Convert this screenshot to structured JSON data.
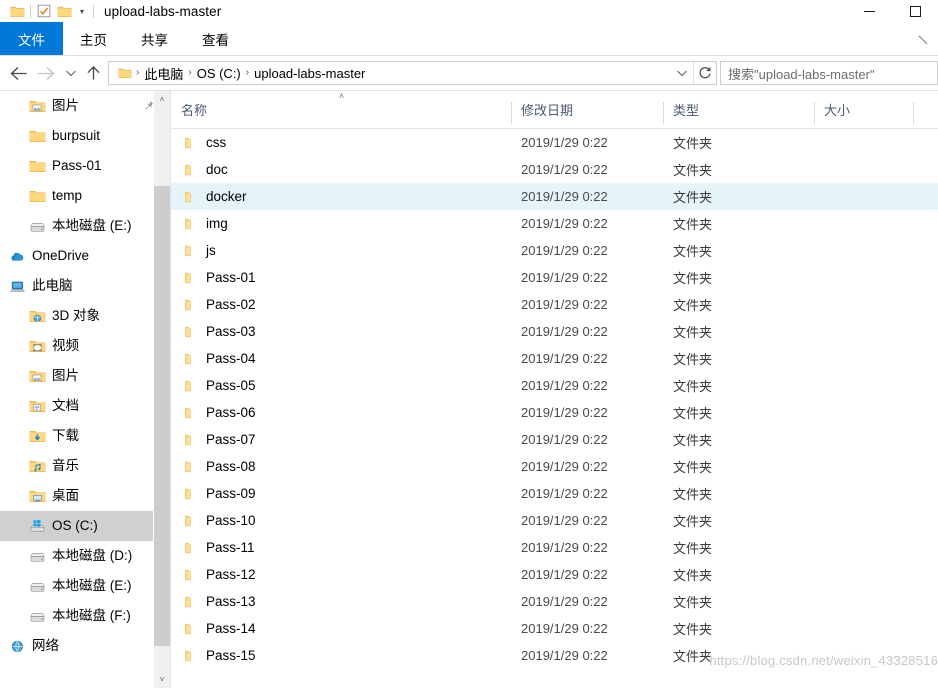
{
  "window": {
    "title": "upload-labs-master",
    "quick_access": [
      {
        "name": "folder-icon",
        "label": "folder"
      },
      {
        "name": "properties-icon",
        "label": "properties"
      },
      {
        "name": "new-folder-icon",
        "label": "new folder"
      }
    ],
    "customize_caret": "▾",
    "controls": {
      "minimize": "minimize",
      "maximize": "maximize"
    }
  },
  "ribbon": {
    "tabs": [
      {
        "label": "文件",
        "active": true
      },
      {
        "label": "主页",
        "active": false
      },
      {
        "label": "共享",
        "active": false
      },
      {
        "label": "查看",
        "active": false
      }
    ],
    "expand_label": "expand ribbon"
  },
  "navbar": {
    "back": "←",
    "forward": "→",
    "recent": "˅",
    "up": "↑",
    "breadcrumb": [
      "此电脑",
      "OS (C:)",
      "upload-labs-master"
    ],
    "separator": "›",
    "dropdown": "˅",
    "refresh": "↻"
  },
  "search": {
    "placeholder": "搜索\"upload-labs-master\""
  },
  "sidebar": {
    "items": [
      {
        "label": "图片",
        "icon": "folder-pictures-icon",
        "indent": 1,
        "pinned": true,
        "selected": false
      },
      {
        "label": "burpsuit",
        "icon": "folder-icon",
        "indent": 1,
        "pinned": false,
        "selected": false
      },
      {
        "label": "Pass-01",
        "icon": "folder-icon",
        "indent": 1,
        "pinned": false,
        "selected": false
      },
      {
        "label": "temp",
        "icon": "folder-icon",
        "indent": 1,
        "pinned": false,
        "selected": false
      },
      {
        "label": "本地磁盘 (E:)",
        "icon": "drive-icon",
        "indent": 1,
        "pinned": false,
        "selected": false
      },
      {
        "label": "OneDrive",
        "icon": "onedrive-cloud-icon",
        "indent": 0,
        "pinned": false,
        "selected": false
      },
      {
        "label": "此电脑",
        "icon": "this-pc-icon",
        "indent": 0,
        "pinned": false,
        "selected": false
      },
      {
        "label": "3D 对象",
        "icon": "folder-3d-objects-icon",
        "indent": 1,
        "pinned": false,
        "selected": false
      },
      {
        "label": "视频",
        "icon": "folder-videos-icon",
        "indent": 1,
        "pinned": false,
        "selected": false
      },
      {
        "label": "图片",
        "icon": "folder-pictures-icon",
        "indent": 1,
        "pinned": false,
        "selected": false
      },
      {
        "label": "文档",
        "icon": "folder-documents-icon",
        "indent": 1,
        "pinned": false,
        "selected": false
      },
      {
        "label": "下载",
        "icon": "folder-downloads-icon",
        "indent": 1,
        "pinned": false,
        "selected": false
      },
      {
        "label": "音乐",
        "icon": "folder-music-icon",
        "indent": 1,
        "pinned": false,
        "selected": false
      },
      {
        "label": "桌面",
        "icon": "folder-desktop-icon",
        "indent": 1,
        "pinned": false,
        "selected": false
      },
      {
        "label": "OS (C:)",
        "icon": "windows-drive-icon",
        "indent": 1,
        "pinned": false,
        "selected": true
      },
      {
        "label": "本地磁盘 (D:)",
        "icon": "drive-icon",
        "indent": 1,
        "pinned": false,
        "selected": false
      },
      {
        "label": "本地磁盘 (E:)",
        "icon": "drive-icon",
        "indent": 1,
        "pinned": false,
        "selected": false
      },
      {
        "label": "本地磁盘 (F:)",
        "icon": "drive-icon",
        "indent": 1,
        "pinned": false,
        "selected": false
      },
      {
        "label": "网络",
        "icon": "network-icon",
        "indent": 0,
        "pinned": false,
        "selected": false
      }
    ],
    "scroll_up": "˄",
    "scroll_down": "˅"
  },
  "file_list": {
    "columns": [
      {
        "label": "名称",
        "sorted": "asc"
      },
      {
        "label": "修改日期",
        "sorted": null
      },
      {
        "label": "类型",
        "sorted": null
      },
      {
        "label": "大小",
        "sorted": null
      }
    ],
    "sort_caret": "˄",
    "rows": [
      {
        "name": "css",
        "date": "2019/1/29 0:22",
        "type": "文件夹",
        "size": "",
        "hover": false
      },
      {
        "name": "doc",
        "date": "2019/1/29 0:22",
        "type": "文件夹",
        "size": "",
        "hover": false
      },
      {
        "name": "docker",
        "date": "2019/1/29 0:22",
        "type": "文件夹",
        "size": "",
        "hover": true
      },
      {
        "name": "img",
        "date": "2019/1/29 0:22",
        "type": "文件夹",
        "size": "",
        "hover": false
      },
      {
        "name": "js",
        "date": "2019/1/29 0:22",
        "type": "文件夹",
        "size": "",
        "hover": false
      },
      {
        "name": "Pass-01",
        "date": "2019/1/29 0:22",
        "type": "文件夹",
        "size": "",
        "hover": false
      },
      {
        "name": "Pass-02",
        "date": "2019/1/29 0:22",
        "type": "文件夹",
        "size": "",
        "hover": false
      },
      {
        "name": "Pass-03",
        "date": "2019/1/29 0:22",
        "type": "文件夹",
        "size": "",
        "hover": false
      },
      {
        "name": "Pass-04",
        "date": "2019/1/29 0:22",
        "type": "文件夹",
        "size": "",
        "hover": false
      },
      {
        "name": "Pass-05",
        "date": "2019/1/29 0:22",
        "type": "文件夹",
        "size": "",
        "hover": false
      },
      {
        "name": "Pass-06",
        "date": "2019/1/29 0:22",
        "type": "文件夹",
        "size": "",
        "hover": false
      },
      {
        "name": "Pass-07",
        "date": "2019/1/29 0:22",
        "type": "文件夹",
        "size": "",
        "hover": false
      },
      {
        "name": "Pass-08",
        "date": "2019/1/29 0:22",
        "type": "文件夹",
        "size": "",
        "hover": false
      },
      {
        "name": "Pass-09",
        "date": "2019/1/29 0:22",
        "type": "文件夹",
        "size": "",
        "hover": false
      },
      {
        "name": "Pass-10",
        "date": "2019/1/29 0:22",
        "type": "文件夹",
        "size": "",
        "hover": false
      },
      {
        "name": "Pass-11",
        "date": "2019/1/29 0:22",
        "type": "文件夹",
        "size": "",
        "hover": false
      },
      {
        "name": "Pass-12",
        "date": "2019/1/29 0:22",
        "type": "文件夹",
        "size": "",
        "hover": false
      },
      {
        "name": "Pass-13",
        "date": "2019/1/29 0:22",
        "type": "文件夹",
        "size": "",
        "hover": false
      },
      {
        "name": "Pass-14",
        "date": "2019/1/29 0:22",
        "type": "文件夹",
        "size": "",
        "hover": false
      },
      {
        "name": "Pass-15",
        "date": "2019/1/29 0:22",
        "type": "文件夹",
        "size": "",
        "hover": false
      }
    ]
  },
  "watermark": {
    "text": "https://blog.csdn.net/weixin_43328516"
  },
  "colors": {
    "accent": "#0078d7",
    "folder": "#ffd778",
    "hover_row": "#e5f3fb",
    "selected_nav": "#d0d0d0",
    "header_text": "#4a5b73"
  }
}
